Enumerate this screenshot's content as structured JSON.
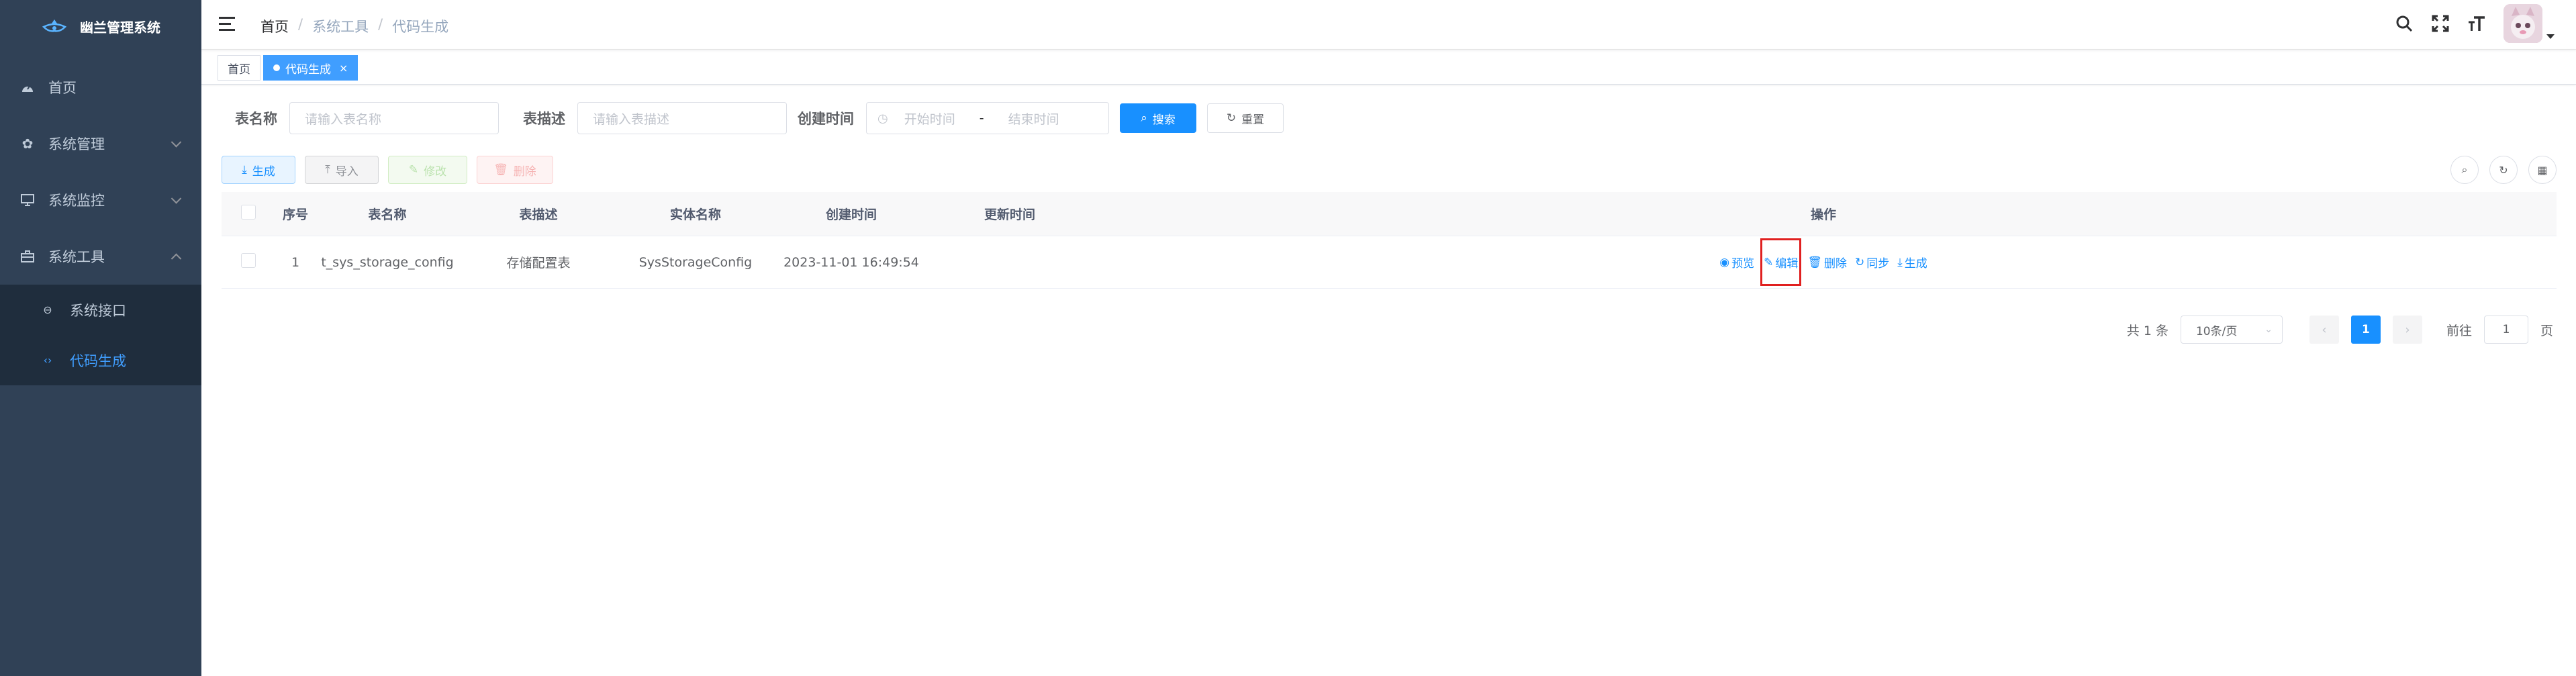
{
  "app": {
    "title": "幽兰管理系统"
  },
  "sidebar": {
    "items": [
      {
        "label": "首页",
        "icon": "dashboard-icon"
      },
      {
        "label": "系统管理",
        "icon": "gear-icon"
      },
      {
        "label": "系统监控",
        "icon": "monitor-icon"
      },
      {
        "label": "系统工具",
        "icon": "toolbox-icon"
      }
    ],
    "subitems": [
      {
        "label": "系统接口",
        "icon": "api-icon"
      },
      {
        "label": "代码生成",
        "icon": "code-icon"
      }
    ]
  },
  "breadcrumb": [
    "首页",
    "系统工具",
    "代码生成"
  ],
  "tags": {
    "home": "首页",
    "active": "代码生成",
    "close": "×"
  },
  "search": {
    "table_name_label": "表名称",
    "table_name_placeholder": "请输入表名称",
    "table_desc_label": "表描述",
    "table_desc_placeholder": "请输入表描述",
    "create_time_label": "创建时间",
    "start_placeholder": "开始时间",
    "range_separator": "-",
    "end_placeholder": "结束时间",
    "search_button": "搜索",
    "reset_button": "重置"
  },
  "toolbar": {
    "generate": "生成",
    "import": "导入",
    "edit": "修改",
    "delete": "删除"
  },
  "table": {
    "headers": [
      "序号",
      "表名称",
      "表描述",
      "实体名称",
      "创建时间",
      "更新时间",
      "操作"
    ],
    "rows": [
      {
        "index": "1",
        "table_name": "t_sys_storage_config",
        "table_desc": "存储配置表",
        "entity": "SysStorageConfig",
        "created": "2023-11-01 16:49:54",
        "updated": ""
      }
    ],
    "ops": {
      "preview": "预览",
      "edit": "编辑",
      "delete": "删除",
      "sync": "同步",
      "generate": "生成"
    }
  },
  "pagination": {
    "total": "共 1 条",
    "page_size": "10条/页",
    "current": "1",
    "goto": "前往",
    "goto_value": "1",
    "page_unit": "页"
  },
  "colors": {
    "sidebar": "#304156",
    "primary": "#1890ff",
    "highlight": "#e02020"
  }
}
